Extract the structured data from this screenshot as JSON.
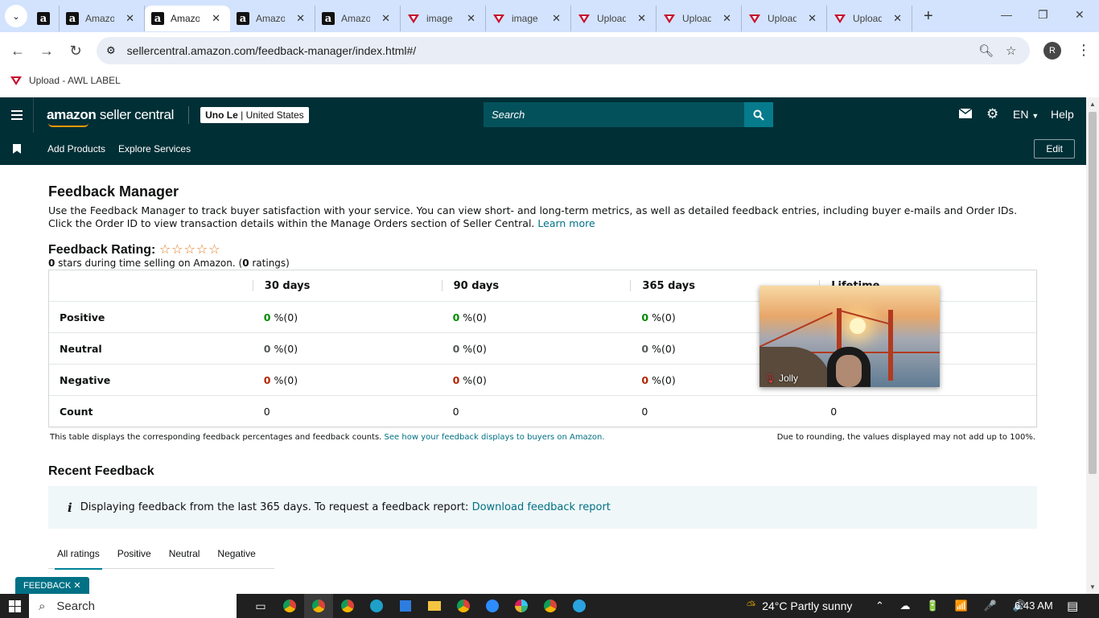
{
  "browser": {
    "tabs": [
      {
        "title": "",
        "favicon": "amazon-a",
        "active": false
      },
      {
        "title": "Amazon",
        "favicon": "amazon-a",
        "active": false
      },
      {
        "title": "Amazon",
        "favicon": "amazon-a",
        "active": true
      },
      {
        "title": "Amazon",
        "favicon": "amazon-a",
        "active": false
      },
      {
        "title": "Amazon",
        "favicon": "amazon-a",
        "active": false
      },
      {
        "title": "image",
        "favicon": "v-logo",
        "active": false
      },
      {
        "title": "image",
        "favicon": "v-logo",
        "active": false
      },
      {
        "title": "Upload",
        "favicon": "v-logo",
        "active": false
      },
      {
        "title": "Upload",
        "favicon": "v-logo",
        "active": false
      },
      {
        "title": "Upload",
        "favicon": "v-logo",
        "active": false
      },
      {
        "title": "Upload",
        "favicon": "v-logo",
        "active": false
      }
    ],
    "url": "sellercentral.amazon.com/feedback-manager/index.html#/",
    "profile_initial": "R",
    "bookmark": "Upload - AWL LABEL"
  },
  "header": {
    "logo_bold": "amazon",
    "logo_rest": " seller central",
    "account_name": "Uno Le",
    "account_region": "United States",
    "search_placeholder": "Search",
    "language": "EN",
    "help": "Help",
    "sub_links": [
      "Add Products",
      "Explore Services"
    ],
    "edit": "Edit"
  },
  "page": {
    "title": "Feedback Manager",
    "description": "Use the Feedback Manager to track buyer satisfaction with your service. You can view short- and long-term metrics, as well as detailed feedback entries, including buyer e-mails and Order IDs. Click the Order ID to view transaction details within the Manage Orders section of Seller Central.",
    "learn_more": "Learn more",
    "rating_title": "Feedback Rating:",
    "rating_stars": "☆☆☆☆☆",
    "rating_sub_value": "0",
    "rating_sub_text": " stars during time selling on Amazon. (",
    "rating_sub_count": "0",
    "rating_sub_end": " ratings)",
    "table": {
      "columns": [
        "30 days",
        "90 days",
        "365 days",
        "Lifetime"
      ],
      "rows": [
        {
          "label": "Positive",
          "cells": [
            [
              "0",
              "%(0)"
            ],
            [
              "0",
              "%(0)"
            ],
            [
              "0",
              "%(0)"
            ],
            [
              "",
              ""
            ]
          ]
        },
        {
          "label": "Neutral",
          "cells": [
            [
              "0",
              "%(0)"
            ],
            [
              "0",
              "%(0)"
            ],
            [
              "0",
              "%(0)"
            ],
            [
              "",
              ""
            ]
          ]
        },
        {
          "label": "Negative",
          "cells": [
            [
              "0",
              "%(0)"
            ],
            [
              "0",
              "%(0)"
            ],
            [
              "0",
              "%(0)"
            ],
            [
              "",
              ""
            ]
          ]
        },
        {
          "label": "Count",
          "cells": [
            [
              "0",
              ""
            ],
            [
              "0",
              ""
            ],
            [
              "0",
              ""
            ],
            [
              "0",
              ""
            ]
          ]
        }
      ]
    },
    "note_left": "This table displays the corresponding feedback percentages and feedback counts.",
    "note_left_link": "See how your feedback displays to buyers on Amazon.",
    "note_right": "Due to rounding, the values displayed may not add up to 100%.",
    "recent_title": "Recent Feedback",
    "info_text": "Displaying feedback from the last 365 days. To request a feedback report:",
    "info_link": "Download feedback report",
    "filter_tabs": [
      "All ratings",
      "Positive",
      "Neutral",
      "Negative"
    ],
    "feedback_pill": "FEEDBACK ✕"
  },
  "video": {
    "name": "Jolly"
  },
  "taskbar": {
    "search": "Search",
    "weather": "24°C  Partly sunny",
    "time": "6:43 AM"
  },
  "colors": {
    "header_bg": "#002f36",
    "search_btn": "#067b8c",
    "link": "#007185",
    "positive": "#008a00",
    "negative": "#b12704",
    "star": "#de7921"
  }
}
